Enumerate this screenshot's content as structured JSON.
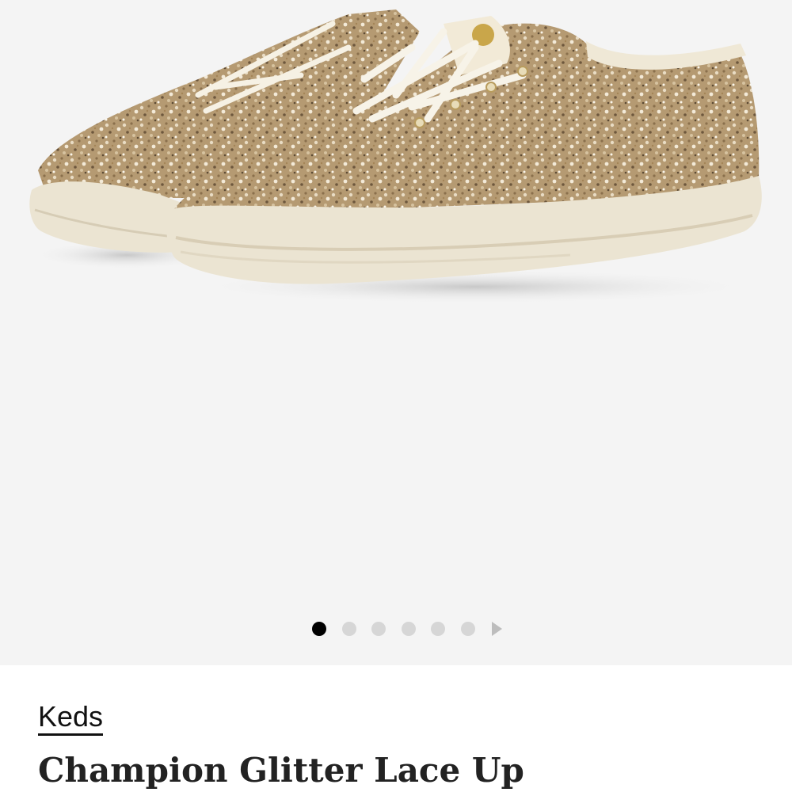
{
  "gallery": {
    "image_icon": "product-photo-gold-glitter-sneakers",
    "background": "#f4f4f4",
    "dot_count": 6,
    "active_index": 0,
    "next_icon": "chevron-right-icon"
  },
  "product": {
    "brand": "Keds",
    "title": "Champion Glitter Lace Up"
  }
}
